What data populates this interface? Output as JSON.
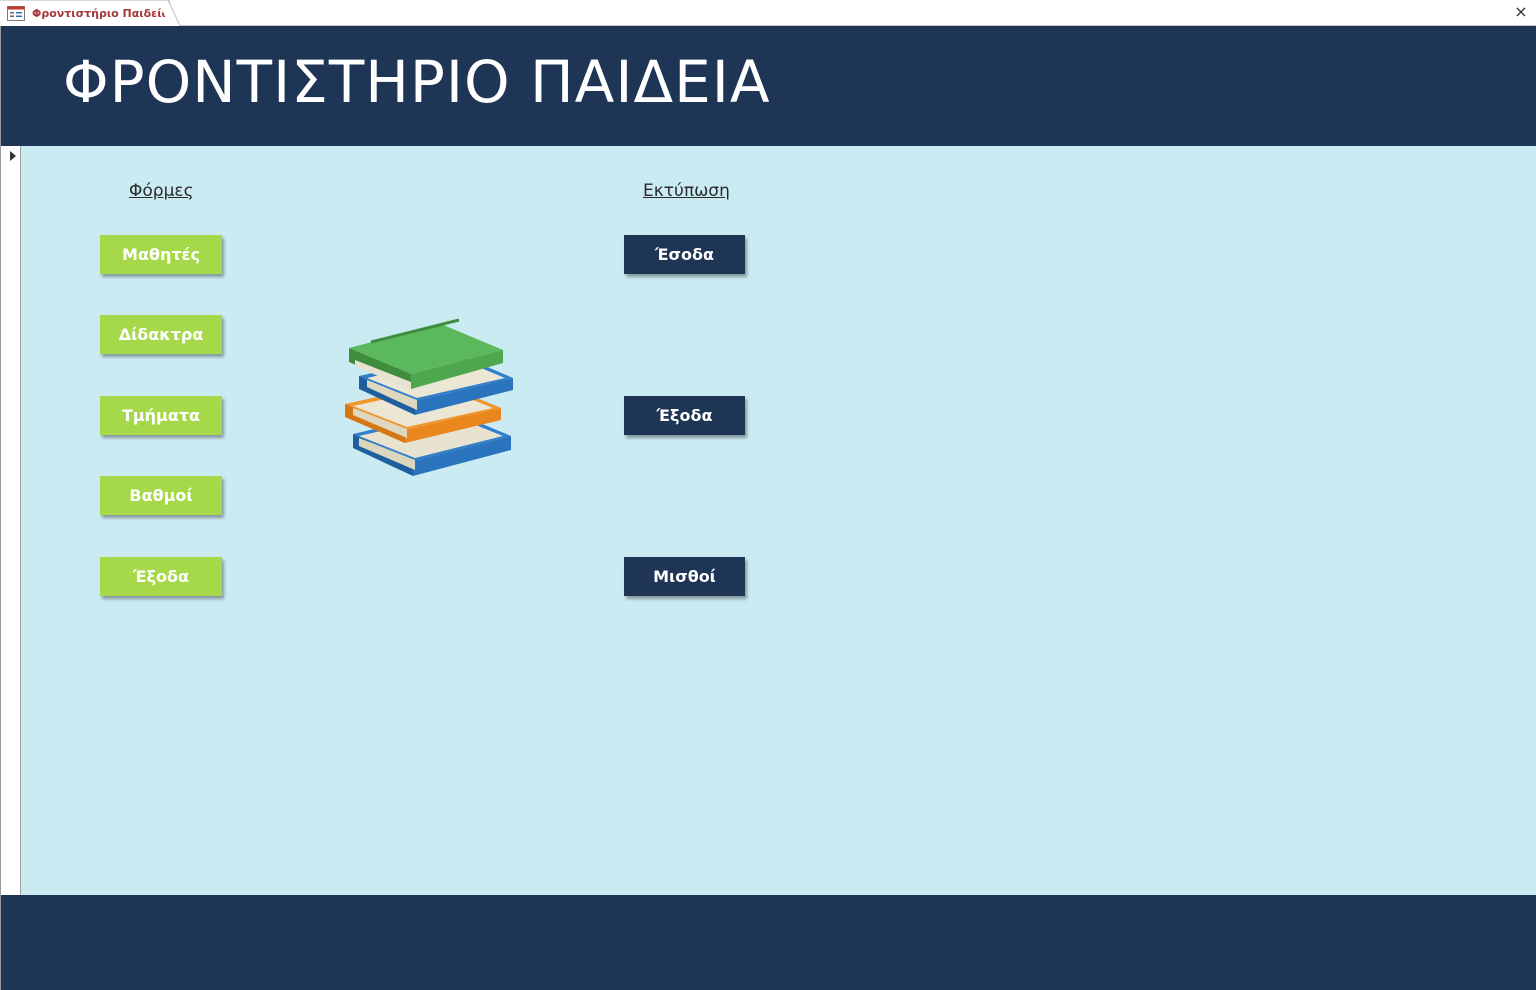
{
  "window": {
    "tab_title": "Φροντιστήριο Παιδεία",
    "tab_icon": "form-icon",
    "close_symbol": "×"
  },
  "header": {
    "title": "ΦΡΟΝΤΙΣΤΗΡΙΟ ΠΑΙΔΕΙΑ"
  },
  "forms_section": {
    "label": "Φόρμες",
    "buttons": [
      "Μαθητές",
      "Δίδακτρα",
      "Τμήματα",
      "Βαθμοί",
      "Έξοδα"
    ]
  },
  "print_section": {
    "label": "Εκτύπωση",
    "buttons": [
      "Έσοδα",
      "Έξοδα",
      "Μισθοί"
    ]
  },
  "image": {
    "icon": "books-stack-icon"
  },
  "colors": {
    "header_bg": "#1e3556",
    "detail_bg": "#cbebf3",
    "green_button": "#a6d94a",
    "navy_button": "#1e3556",
    "tab_text": "#a4373a"
  }
}
